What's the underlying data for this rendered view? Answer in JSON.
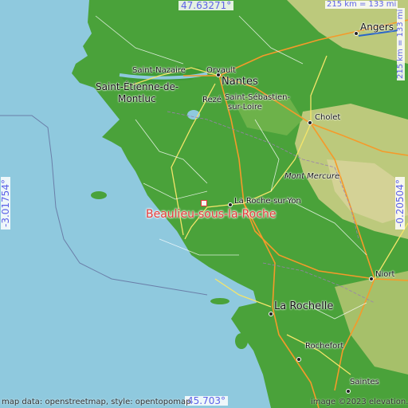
{
  "coords": {
    "top": "47.63271°",
    "bottom": "45.703°",
    "left": "-3.01754°",
    "right": "-0.20504°"
  },
  "scale": {
    "top": "215 km = 133 mi",
    "right": "215 km = 133 mi"
  },
  "place": "Beaulieu-sous-la-Roche",
  "cities": {
    "angers": "Angers",
    "saint_nazaire": "Saint-Nazaire",
    "orvault": "Orvault",
    "nantes": "Nantes",
    "saint_etienne_line1": "Saint-Étienne-de-",
    "saint_etienne_line2": "Montluc",
    "reze": "Rezé",
    "saint_sebastien_line1": "Saint-Sébastien-",
    "saint_sebastien_line2": "sur-Loire",
    "cholet": "Cholet",
    "mont_mercure": "Mont Mercure",
    "la_roche_sur_yon": "La Roche-sur-Yon",
    "niort": "Niort",
    "la_rochelle": "La Rochelle",
    "rochefort": "Rochefort",
    "saintes": "Saintes"
  },
  "credits": {
    "left": "map data: openstreetmap, style: opentopomap",
    "right": "image ©2023 elevation.city"
  },
  "colors": {
    "sea": "#8fc9de",
    "lowland": "#4aa23a",
    "upland": "#bcc97c",
    "highlight": "#e53a3a",
    "coord_text": "#5c61e8"
  }
}
